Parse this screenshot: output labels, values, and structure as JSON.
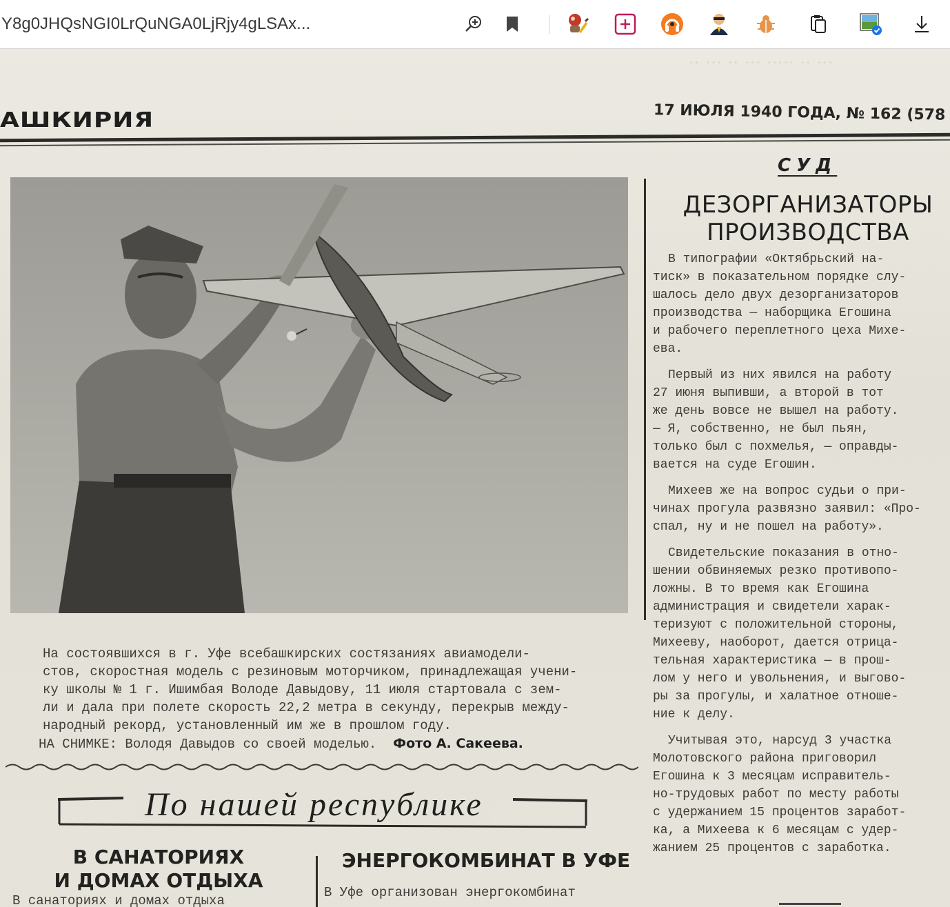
{
  "browser": {
    "url": "Y8g0JHQsNGI0LrQuNGA0LjRjy4gLSAx...",
    "toolbar_icons": [
      "zoom-icon",
      "bookmark-icon",
      "extension-painter-icon",
      "add-collection-icon",
      "headphones-extension-icon",
      "agent-extension-icon",
      "bug-extension-icon",
      "clipboard-copy-icon",
      "image-viewer-icon",
      "download-icon"
    ],
    "accent_colors": {
      "collection": "#c2185b",
      "headphones": "#f47b20",
      "check_badge": "#1a73e8"
    }
  },
  "newspaper": {
    "masthead_name": "АШКИРИЯ",
    "masthead_date": "17 ИЮЛЯ 1940 ГОДА, № 162 (578",
    "photo": {
      "alt": "Boy holding rubber-powered model airplane",
      "caption_lines": [
        "На состоявшихся в г. Уфе всебашкирских состязаниях авиамодели-",
        "стов, скоростная модель с резиновым моторчиком, принадлежащая учени-",
        "ку школы № 1 г. Ишимбая Володе Давыдову, 11 июля стартовала с зем-",
        "ли и дала при полете скорость 22,2 метра в секунду, перекрыв между-",
        "народный рекорд, установленный им же в прошлом году."
      ],
      "caption_footer": "НА СНИМКЕ: Володя Давыдов со своей моделью.",
      "credit": "Фото А. Сакеева."
    },
    "section_title": "По нашей республике",
    "left_article": {
      "headline_line1": "В САНАТОРИЯХ",
      "headline_line2": "И ДОМАХ ОТДЫХА",
      "text": "В санаториях и домах отдыха"
    },
    "right_lower_article": {
      "headline": "ЭНЕРГОКОМБИНАТ В УФЕ",
      "text": "В Уфе организован энергокомбинат"
    },
    "court_article": {
      "kicker": "СУД",
      "headline_line1": "ДЕЗОРГАНИЗАТОРЫ",
      "headline_line2": "ПРОИЗВОДСТВА",
      "paragraphs": [
        [
          "В типографии «Октябрьский на-",
          "тиск» в показательном порядке слу-",
          "шалось дело двух дезорганизаторов",
          "производства — наборщика Егошина",
          "и рабочего переплетного цеха Михе-",
          "ева."
        ],
        [
          "Первый из них явился на работу",
          "27 июня выпивши, а второй в тот",
          "же день вовсе не вышел на работу.",
          "— Я, собственно, не был пьян,",
          "только был с похмелья, — оправды-",
          "вается на суде Егошин."
        ],
        [
          "Михеев же на вопрос судьи о при-",
          "чинах прогула развязно заявил: «Про-",
          "спал, ну и не пошел на работу»."
        ],
        [
          "Свидетельские показания в отно-",
          "шении обвиняемых резко противопо-",
          "ложны. В то время как Егошина",
          "администрация и свидетели харак-",
          "теризуют с положительной стороны,",
          "Михееву, наоборот, дается отрица-",
          "тельная характеристика — в прош-",
          "лом у него и увольнения, и выгово-",
          "ры за прогулы, и халатное отноше-",
          "ние к делу."
        ],
        [
          "Учитывая это, нарсуд 3 участка",
          "Молотовского района приговорил",
          "Егошина к 3 месяцам исправитель-",
          "но-трудовых работ по месту работы",
          "с удержанием 15 процентов заработ-",
          "ка, а Михеева к 6 месяцам с удер-",
          "жанием 25 процентов с заработка."
        ]
      ]
    }
  }
}
